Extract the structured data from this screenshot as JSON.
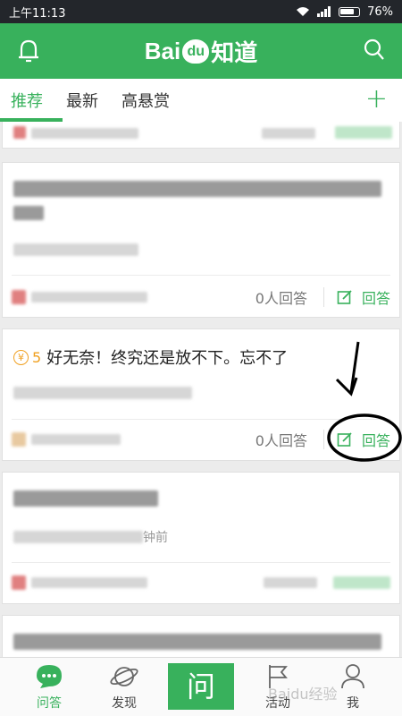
{
  "status_bar": {
    "time": "上午11:13",
    "battery": "76%"
  },
  "header": {
    "logo_left": "Bai",
    "logo_du": "du",
    "logo_right": "知道"
  },
  "tabs": [
    {
      "label": "推荐",
      "active": true
    },
    {
      "label": "最新",
      "active": false
    },
    {
      "label": "高悬赏",
      "active": false
    }
  ],
  "tabs_plus": "+",
  "feed": {
    "card2": {
      "answer_count": "0人回答",
      "answer_label": "回答"
    },
    "card3": {
      "reward": "5",
      "question": "好无奈！终究还是放不下。忘不了",
      "answer_count": "0人回答",
      "answer_label": "回答"
    },
    "card4": {
      "time_suffix": "钟前"
    }
  },
  "bottom_nav": {
    "qa": "问答",
    "discover": "发现",
    "ask": "问",
    "activity": "活动",
    "me": "我"
  },
  "watermark": "Baidu经验",
  "colors": {
    "brand_green": "#38b15c",
    "reward_orange": "#f0a020"
  }
}
